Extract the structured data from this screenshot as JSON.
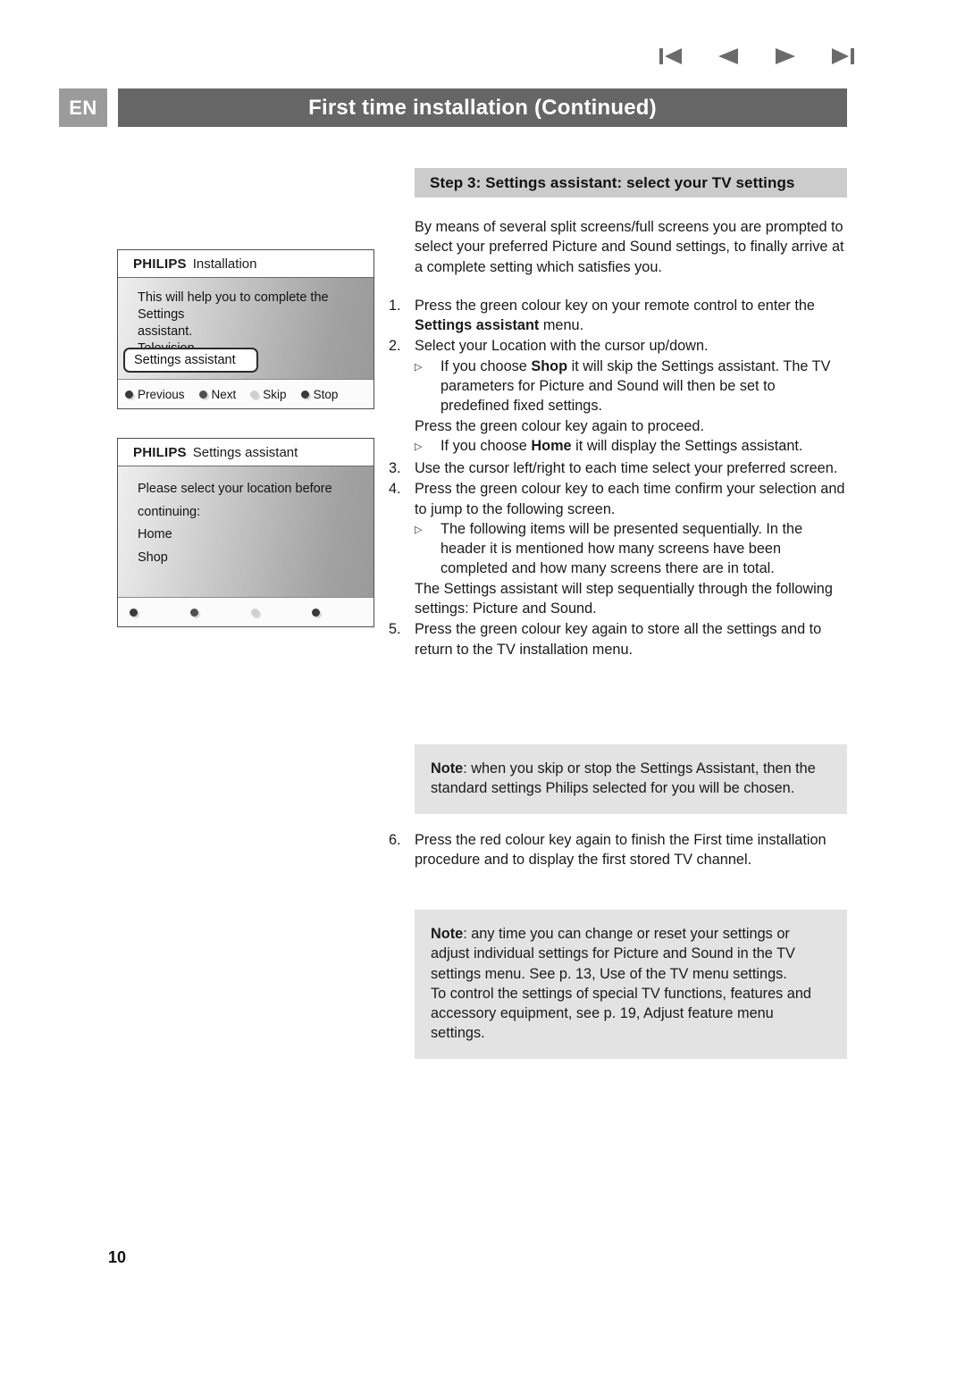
{
  "nav": {
    "buttons": [
      {
        "name": "first-page-icon",
        "label": "First page"
      },
      {
        "name": "previous-page-icon",
        "label": "Previous page"
      },
      {
        "name": "next-page-icon",
        "label": "Next page"
      },
      {
        "name": "last-page-icon",
        "label": "Last page"
      }
    ]
  },
  "header": {
    "language": "EN",
    "title": "First time installation  (Continued)"
  },
  "step": {
    "title": "Step 3: Settings assistant: select your TV settings"
  },
  "tv_screens": [
    {
      "brand": "PHILIPS",
      "screen_name": "Installation",
      "lines": [
        "This will help you to complete the Settings",
        "assistant.",
        "Television"
      ],
      "highlight": "Settings assistant",
      "footer_keys": [
        {
          "label": "Previous",
          "dot": "d-dark"
        },
        {
          "label": "Next",
          "dot": "d-mid"
        },
        {
          "label": "Skip",
          "dot": "d-light"
        },
        {
          "label": "Stop",
          "dot": "d-dark"
        }
      ]
    },
    {
      "brand": "PHILIPS",
      "screen_name": "Settings assistant",
      "lines": [
        "Please select your location before",
        "continuing:",
        "Home",
        "Shop"
      ],
      "footer_keys": [
        {
          "label": "",
          "dot": "d-dark"
        },
        {
          "label": "",
          "dot": "d-mid"
        },
        {
          "label": "",
          "dot": "d-light"
        },
        {
          "label": "",
          "dot": "d-dark"
        }
      ]
    }
  ],
  "body": {
    "intro": "By means of several split screens/full screens you are prompted to select your preferred Picture and Sound settings, to finally arrive at a complete setting which satisfies you.",
    "item1_num": "1.",
    "item1_a": "Press the green colour key on your remote control to enter the ",
    "item1_bold": "Settings assistant",
    "item1_b": " menu.",
    "item2_num": "2.",
    "item2": "Select your Location with the cursor up/down.",
    "bullet_mark": "▷",
    "sub2a_a": "If you choose ",
    "sub2a_bold": "Shop",
    "sub2a_b": " it will skip the Settings assistant. The TV parameters for Picture and Sound will then be set to predefined fixed settings.",
    "item2_mid": "Press the green colour key again to proceed.",
    "sub2b_a": "If you choose ",
    "sub2b_bold": "Home",
    "sub2b_b": " it will display the Settings assistant.",
    "item3_num": "3.",
    "item3": "Use the cursor left/right to each time select your preferred screen.",
    "item4_num": "4.",
    "item4": "Press the green colour key to each time confirm your selection and to jump to the following screen.",
    "sub4": "The following items will be presented sequentially. In the header it is mentioned how many screens have been completed and how many screens there are in total.",
    "item4_tail": "The Settings assistant will step sequentially through the following settings: Picture and Sound.",
    "item5_num": "5.",
    "item5": "Press the green colour key again to store all the settings and to return to the TV installation menu.",
    "item6_num": "6.",
    "item6": "Press the red colour key again to finish the First time installation procedure and to display the first stored TV channel."
  },
  "notes": [
    {
      "label": "Note",
      "text": ": when you skip or stop the Settings Assistant, then the standard settings Philips selected for you will be chosen."
    },
    {
      "label": "Note",
      "text": ": any time you can change or reset your settings or adjust individual settings for Picture and Sound in the TV settings menu. See p. 13, Use of the TV menu settings.",
      "text2": "To control the settings of special TV functions, features and accessory equipment, see p. 19,  Adjust feature menu settings."
    }
  ],
  "footer": {
    "page_number": "10"
  },
  "colors": {
    "header_bar": "#666666",
    "lang_badge": "#9b9b9b",
    "step_bar": "#cccccc",
    "note_bg": "#e3e3e3"
  }
}
